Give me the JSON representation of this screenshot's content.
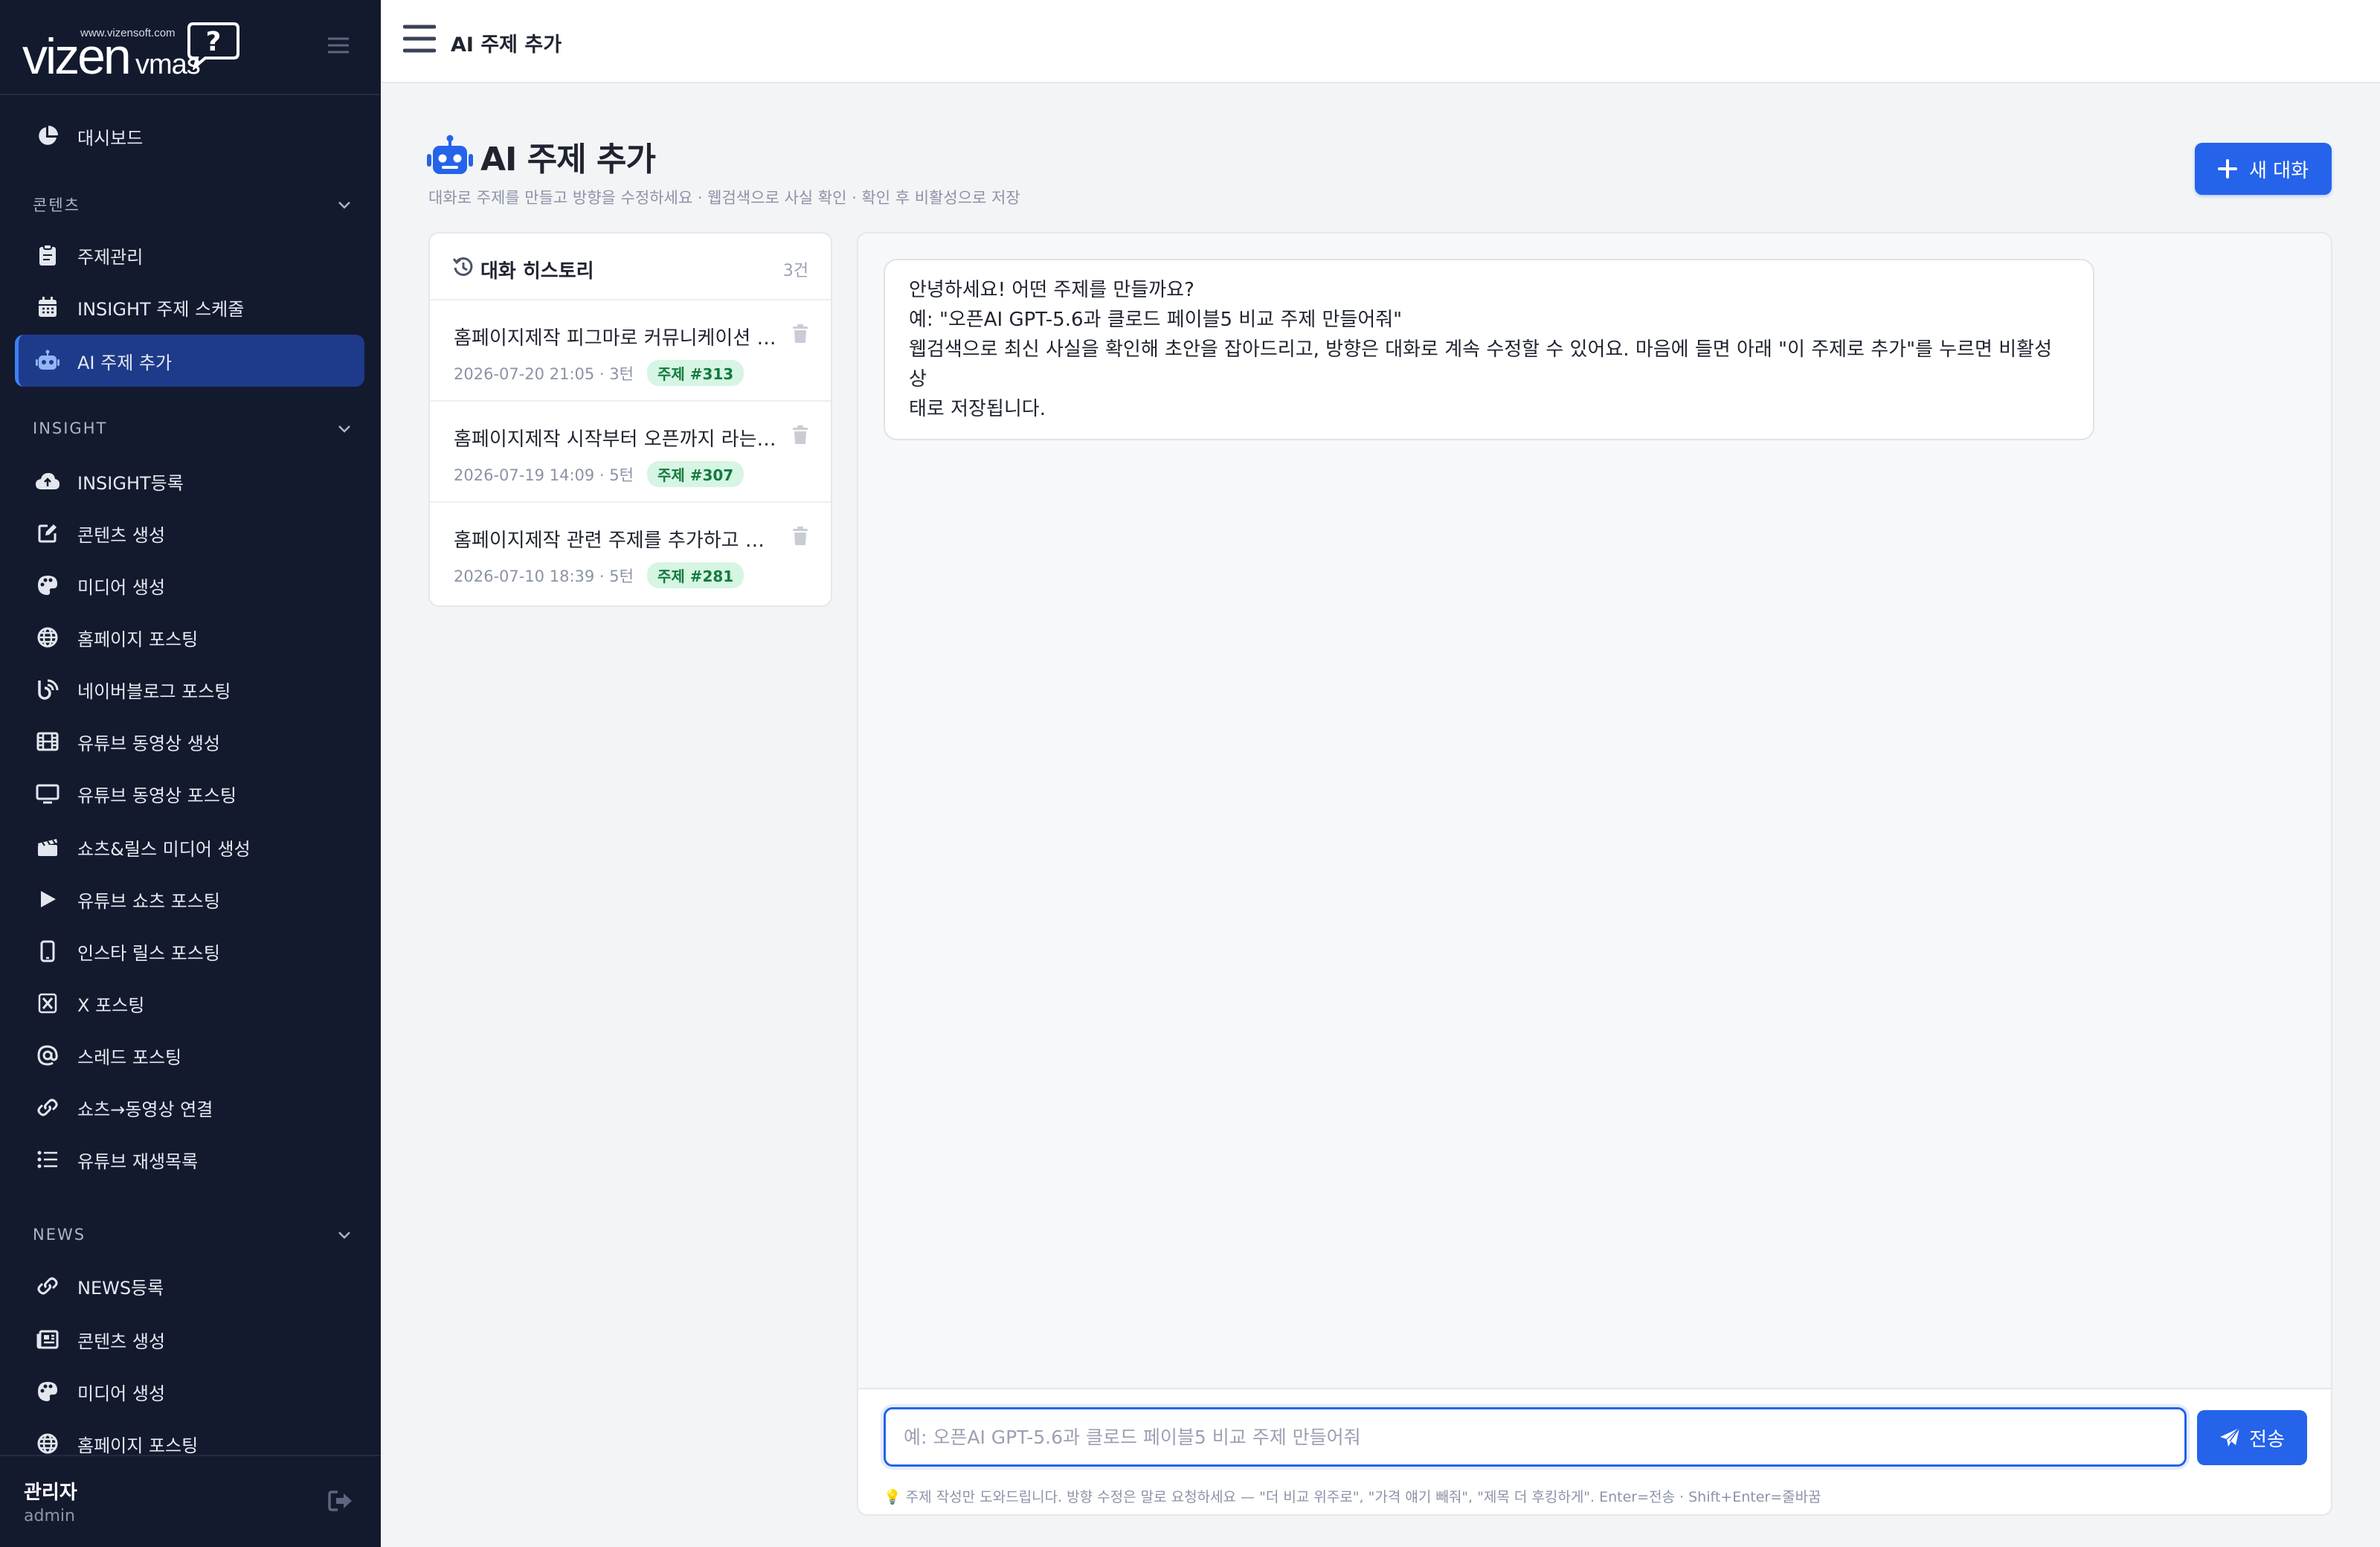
{
  "colors": {
    "sidebar_bg": "#141a2e",
    "accent": "#2563eb",
    "badge_bg": "#d6f5e3",
    "badge_text": "#137a3e"
  },
  "sidebar": {
    "logo": {
      "url_text": "www.vizensoft.com",
      "brand": "vizen",
      "sub": "vmas"
    },
    "items_top": [
      {
        "label": "대시보드",
        "icon": "pie-chart-icon"
      }
    ],
    "sections": [
      {
        "label": "콘텐츠",
        "items": [
          {
            "label": "주제관리",
            "icon": "clipboard-icon"
          },
          {
            "label": "INSIGHT 주제 스케줄",
            "icon": "calendar-icon"
          },
          {
            "label": "AI 주제 추가",
            "icon": "robot-icon",
            "active": true
          }
        ]
      },
      {
        "label": "INSIGHT",
        "items": [
          {
            "label": "INSIGHT등록",
            "icon": "cloud-upload-icon"
          },
          {
            "label": "콘텐츠 생성",
            "icon": "edit-icon"
          },
          {
            "label": "미디어 생성",
            "icon": "palette-icon"
          },
          {
            "label": "홈페이지 포스팅",
            "icon": "globe-icon"
          },
          {
            "label": "네이버블로그 포스팅",
            "icon": "blog-icon"
          },
          {
            "label": "유튜브 동영상 생성",
            "icon": "film-icon"
          },
          {
            "label": "유튜브 동영상 포스팅",
            "icon": "monitor-icon"
          },
          {
            "label": "쇼츠&릴스 미디어 생성",
            "icon": "clapper-icon"
          },
          {
            "label": "유튜브 쇼츠 포스팅",
            "icon": "play-icon"
          },
          {
            "label": "인스타 릴스 포스팅",
            "icon": "mobile-icon"
          },
          {
            "label": "X 포스팅",
            "icon": "x-icon"
          },
          {
            "label": "스레드 포스팅",
            "icon": "at-icon"
          },
          {
            "label": "쇼츠→동영상 연결",
            "icon": "link-icon"
          },
          {
            "label": "유튜브 재생목록",
            "icon": "list-icon"
          }
        ]
      },
      {
        "label": "NEWS",
        "items": [
          {
            "label": "NEWS등록",
            "icon": "link-icon"
          },
          {
            "label": "콘텐츠 생성",
            "icon": "newspaper-icon"
          },
          {
            "label": "미디어 생성",
            "icon": "palette-icon"
          },
          {
            "label": "홈페이지 포스팅",
            "icon": "globe-icon"
          }
        ]
      }
    ],
    "footer": {
      "user_name": "관리자",
      "user_id": "admin"
    }
  },
  "topbar": {
    "title": "AI 주제 추가"
  },
  "page": {
    "title": "AI 주제 추가",
    "subtitle": "대화로 주제를 만들고 방향을 수정하세요 · 웹검색으로 사실 확인 · 확인 후 비활성으로 저장",
    "new_chat_label": "새 대화"
  },
  "history": {
    "title": "대화 히스토리",
    "count": "3건",
    "items": [
      {
        "title": "홈페이지제작 피그마로 커뮤니케이션 하는 방법",
        "meta": "2026-07-20 21:05 · 3턴",
        "badge": "주제 #313"
      },
      {
        "title": "홈페이지제작 시작부터 오픈까지 라는 주제",
        "meta": "2026-07-19 14:09 · 5턴",
        "badge": "주제 #307"
      },
      {
        "title": "홈페이지제작 관련 주제를 추가하고 싶어요",
        "meta": "2026-07-10 18:39 · 5턴",
        "badge": "주제 #281"
      }
    ]
  },
  "chat": {
    "messages": [
      {
        "role": "assistant",
        "lines": [
          "안녕하세요! 어떤 주제를 만들까요?",
          "예: \"오픈AI GPT-5.6과 클로드 페이블5 비교 주제 만들어줘\"",
          "웹검색으로 최신 사실을 확인해 초안을 잡아드리고, 방향은 대화로 계속 수정할 수 있어요. 마음에 들면 아래 \"이 주제로 추가\"를 누르면 비활성 상",
          "태로 저장됩니다."
        ]
      }
    ],
    "input_value": "",
    "input_placeholder": "예: 오픈AI GPT-5.6과 클로드 페이블5 비교 주제 만들어줘",
    "send_label": "전송",
    "hint": "💡 주제 작성만 도와드립니다. 방향 수정은 말로 요청하세요 — \"더 비교 위주로\", \"가격 얘기 빼줘\", \"제목 더 후킹하게\". Enter=전송 · Shift+Enter=줄바꿈"
  }
}
